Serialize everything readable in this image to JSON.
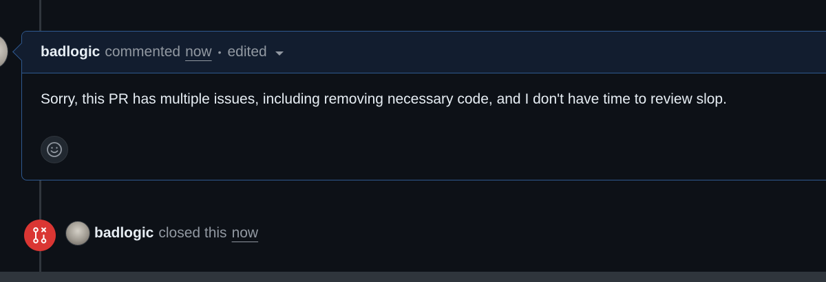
{
  "comment": {
    "author": "badlogic",
    "action": "commented",
    "timestamp": "now",
    "separator": "•",
    "edited_label": "edited",
    "body": "Sorry, this PR has multiple issues, including removing necessary code, and I don't have time to review slop.",
    "reaction_icon": "smiley-icon"
  },
  "event": {
    "icon": "git-pull-request-closed-icon",
    "author": "badlogic",
    "action": "closed this",
    "timestamp": "now"
  },
  "colors": {
    "background": "#0d1117",
    "header_background": "#121d2f",
    "border_highlight": "#2f5a91",
    "closed_red": "#da3633",
    "muted_text": "#9198a1",
    "primary_text": "#e6edf3"
  }
}
